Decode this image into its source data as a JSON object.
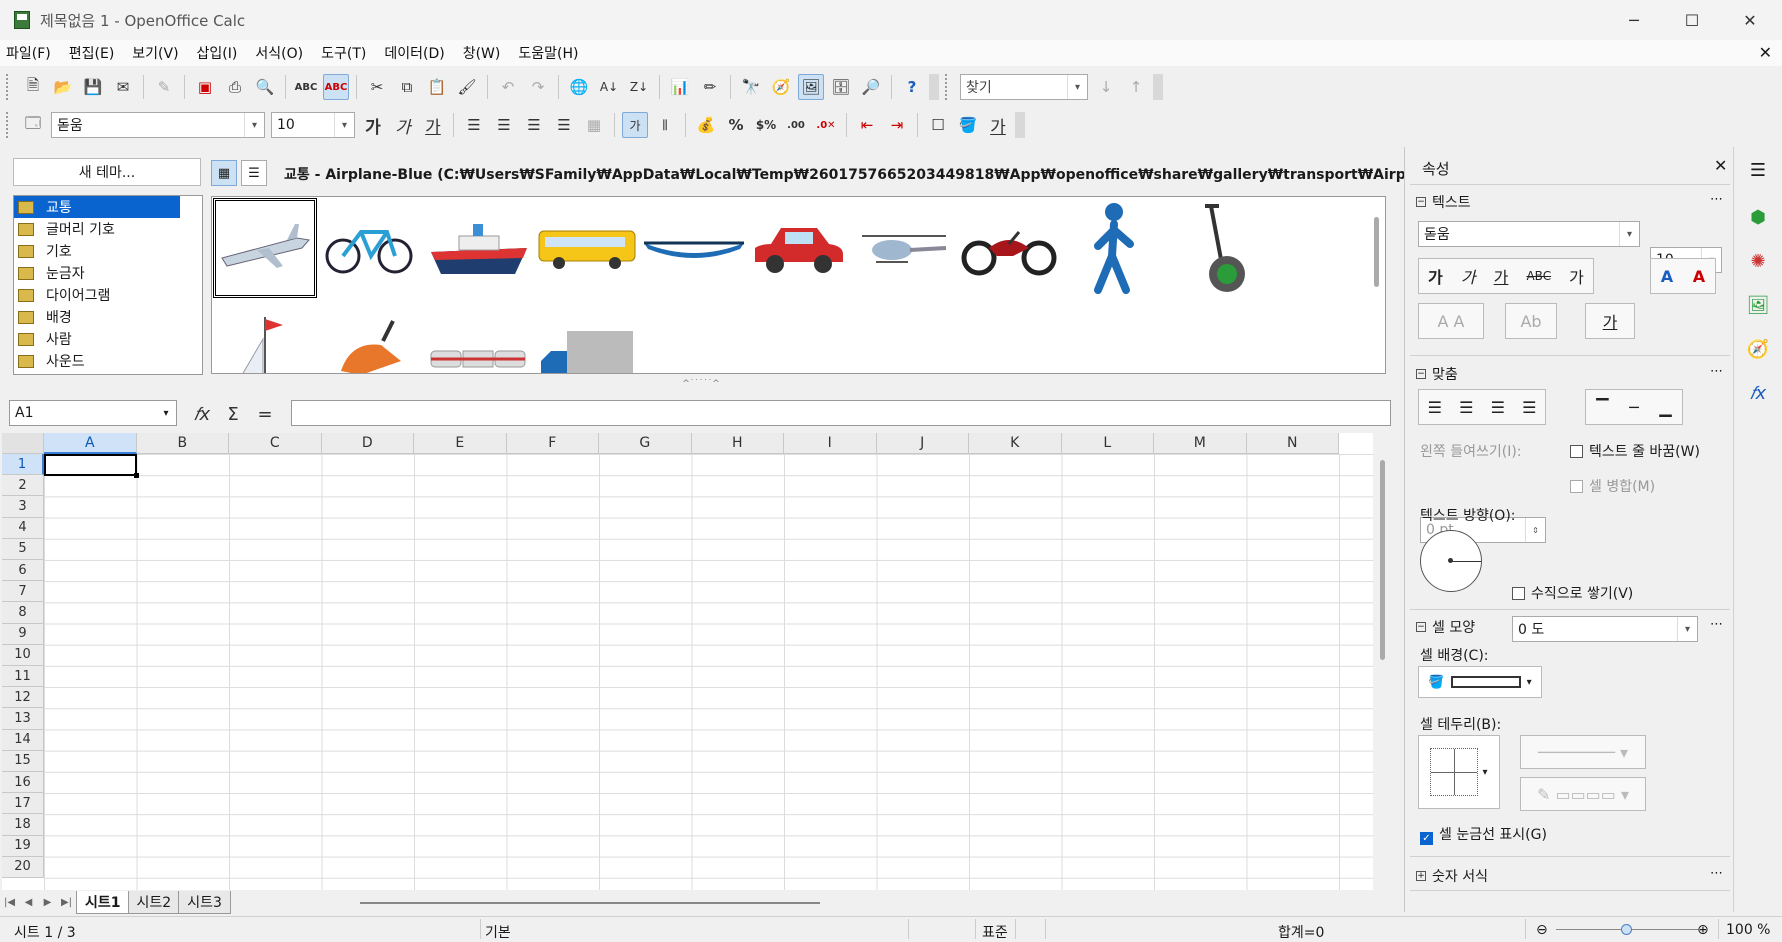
{
  "window": {
    "title": "제목없음 1 - OpenOffice Calc",
    "min": "─",
    "max": "☐",
    "close": "✕"
  },
  "menu": [
    "파일(F)",
    "편집(E)",
    "보기(V)",
    "삽입(I)",
    "서식(O)",
    "도구(T)",
    "데이터(D)",
    "창(W)",
    "도움말(H)"
  ],
  "doc_close": "✕",
  "toolbar1": {
    "find_placeholder": "찾기"
  },
  "toolbar2": {
    "font": "돋움",
    "size": "10"
  },
  "gallery": {
    "new_theme": "새 테마...",
    "path": "교통 - Airplane-Blue (C:₩Users₩SFamily₩AppData₩Local₩Temp₩2601757665203449818₩App₩openoffice₩share₩gallery₩transport₩Airplane-Blue.png)",
    "themes": [
      "교통",
      "글머리 기호",
      "기호",
      "눈금자",
      "다이어그램",
      "배경",
      "사람",
      "사운드"
    ],
    "selected_theme": 0
  },
  "formula": {
    "namebox": "A1",
    "fx": "𝑓x",
    "sum": "Σ",
    "eq": "="
  },
  "sheet": {
    "columns": [
      "A",
      "B",
      "C",
      "D",
      "E",
      "F",
      "G",
      "H",
      "I",
      "J",
      "K",
      "L",
      "M",
      "N"
    ],
    "rows": [
      "1",
      "2",
      "3",
      "4",
      "5",
      "6",
      "7",
      "8",
      "9",
      "10",
      "11",
      "12",
      "13",
      "14",
      "15",
      "16",
      "17",
      "18",
      "19",
      "20"
    ],
    "active_cell": "A1"
  },
  "tabs": [
    "시트1",
    "시트2",
    "시트3"
  ],
  "status": {
    "sheet": "시트 1 / 3",
    "style": "기본",
    "mode": "표준",
    "sum": "합계=0",
    "zoom": "100 %",
    "zoom_level": 0.5
  },
  "sidebar": {
    "title": "속성",
    "close": "✕",
    "text_section": "텍스트",
    "font": "돋움",
    "size": "10",
    "align_section": "맞춤",
    "indent_label": "왼쪽 들여쓰기(I):",
    "indent_value": "0 pt",
    "wrap_label": "텍스트 줄 바꿈(W)",
    "merge_label": "셀 병합(M)",
    "direction_label": "텍스트 방향(O):",
    "angle_value": "0 도",
    "stack_label": "수직으로 쌓기(V)",
    "cell_section": "셀 모양",
    "bg_label": "셀 배경(C):",
    "border_label": "셀 테두리(B):",
    "grid_label": "셀 눈금선 표시(G)",
    "number_section": "숫자 서식"
  }
}
